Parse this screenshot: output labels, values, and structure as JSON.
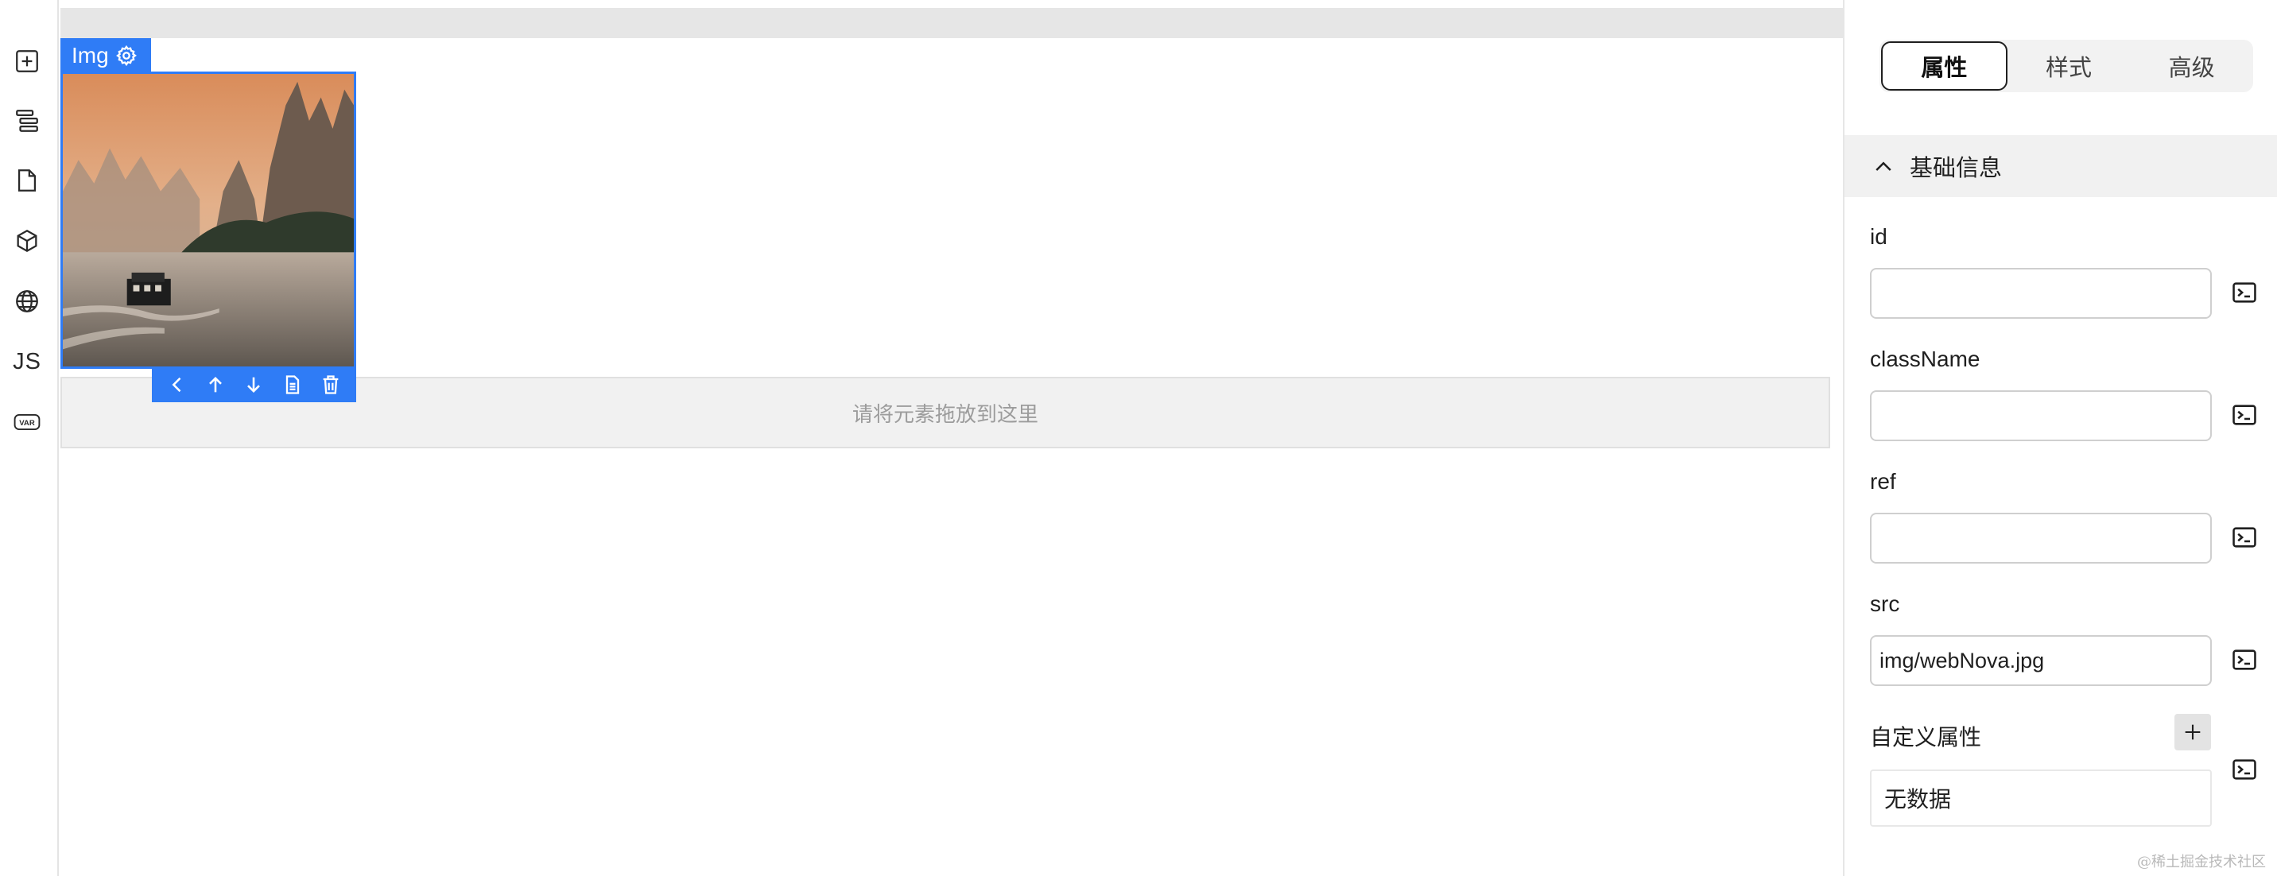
{
  "activity_bar": {
    "items": [
      {
        "icon": "plus-square-icon"
      },
      {
        "icon": "layers-icon"
      },
      {
        "icon": "file-icon"
      },
      {
        "icon": "cube-icon"
      },
      {
        "icon": "globe-icon"
      },
      {
        "icon": "js-icon",
        "label": "JS"
      },
      {
        "icon": "var-icon",
        "label": "VAR"
      }
    ]
  },
  "canvas": {
    "selected_component": "Img",
    "image_src": "img/webNova.jpg",
    "dropzone_text": "请将元素拖放到这里",
    "toolbar_icons": [
      "chevron-left-icon",
      "arrow-up-icon",
      "arrow-down-icon",
      "copy-icon",
      "trash-icon"
    ]
  },
  "panel": {
    "tabs": [
      {
        "label": "属性",
        "active": true
      },
      {
        "label": "样式",
        "active": false
      },
      {
        "label": "高级",
        "active": false
      }
    ],
    "section_title": "基础信息",
    "fields": {
      "id": {
        "label": "id",
        "value": ""
      },
      "className": {
        "label": "className",
        "value": ""
      },
      "ref": {
        "label": "ref",
        "value": ""
      },
      "src": {
        "label": "src",
        "value": "img/webNova.jpg"
      }
    },
    "custom_attrs": {
      "label": "自定义属性",
      "empty_text": "无数据"
    }
  },
  "watermark": "@稀土掘金技术社区",
  "colors": {
    "accent": "#2f7cf6",
    "dropzone_bg": "#f1f1f1",
    "section_bg": "#f1f1f1"
  }
}
